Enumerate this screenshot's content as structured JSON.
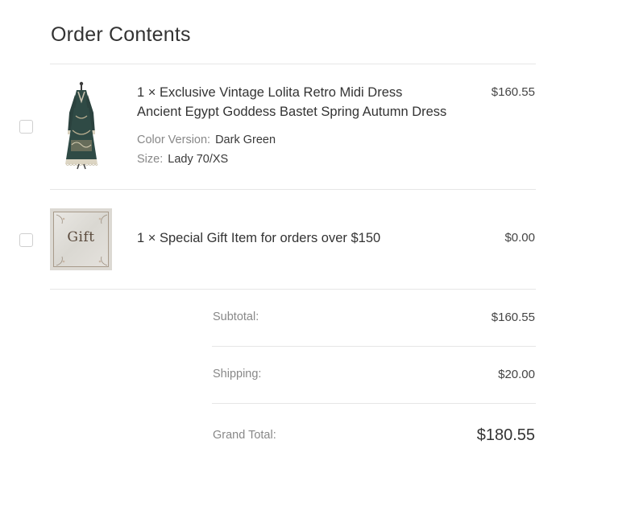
{
  "header": {
    "title": "Order Contents"
  },
  "items": [
    {
      "line1": "1 × Exclusive Vintage Lolita Retro Midi Dress",
      "line2": "Ancient Egypt Goddess Bastet Spring Autumn Dress",
      "price": "$160.55",
      "options": [
        {
          "label": "Color Version:",
          "value": "Dark Green"
        },
        {
          "label": "Size:",
          "value": "Lady 70/XS"
        }
      ],
      "image_icon": "dress-icon",
      "checked": false
    },
    {
      "line1": "1 × Special Gift Item for orders over $150",
      "price": "$0.00",
      "image_text": "Gift",
      "image_icon": "gift-card-icon",
      "checked": false
    }
  ],
  "summary": {
    "subtotal_label": "Subtotal:",
    "subtotal_value": "$160.55",
    "shipping_label": "Shipping:",
    "shipping_value": "$20.00",
    "grand_label": "Grand Total:",
    "grand_value": "$180.55"
  },
  "colors": {
    "divider": "#e6e6e6",
    "text": "#333333",
    "muted": "#888888",
    "dress": "#2f4a45"
  }
}
